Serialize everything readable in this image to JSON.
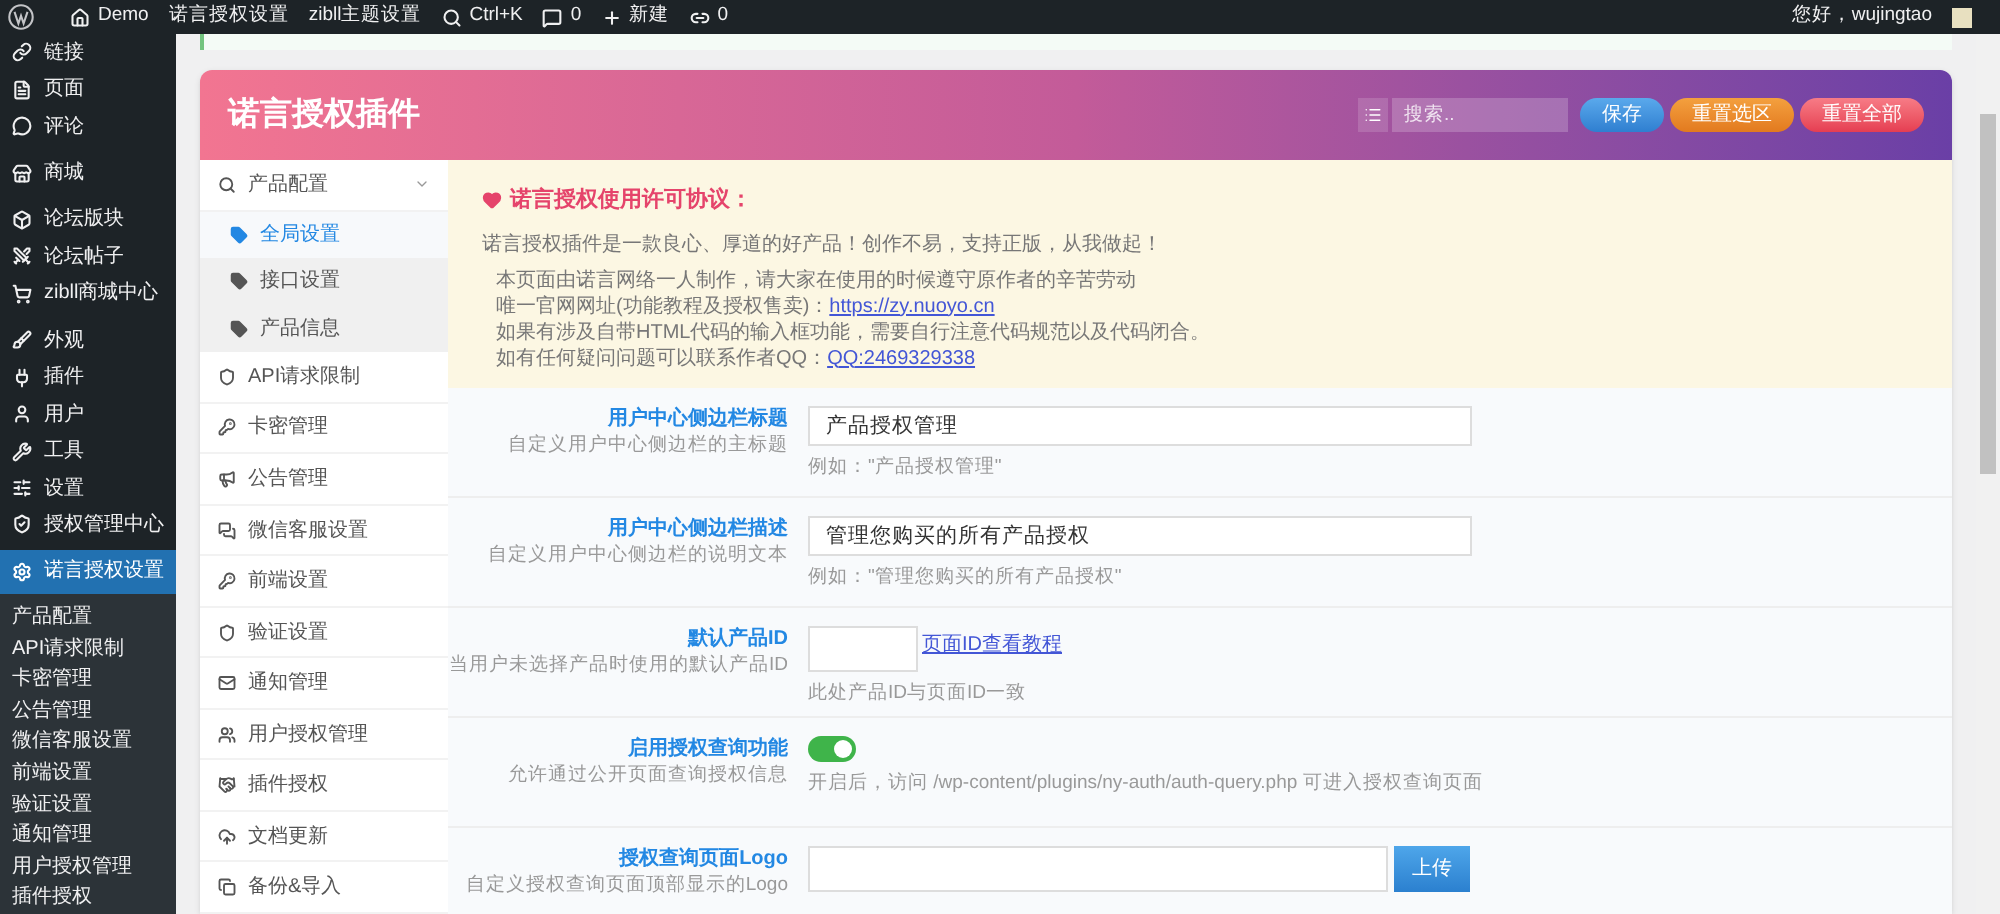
{
  "admin_bar": {
    "items": [
      {
        "kind": "logo"
      },
      {
        "kind": "home",
        "label": "Demo"
      },
      {
        "kind": "text",
        "label": "诺言授权设置"
      },
      {
        "kind": "text",
        "label": "zibll主题设置"
      },
      {
        "kind": "search",
        "label": "Ctrl+K"
      },
      {
        "kind": "comments",
        "label": "0"
      },
      {
        "kind": "new",
        "label": "新建"
      },
      {
        "kind": "links",
        "label": "0"
      }
    ],
    "greeting": "您好，wujingtao"
  },
  "sidebar": {
    "items": [
      {
        "label": "链接",
        "selected": false
      },
      {
        "label": "页面",
        "selected": false
      },
      {
        "label": "评论",
        "selected": false
      },
      {
        "label": "商城",
        "selected": false
      },
      {
        "label": "论坛版块",
        "selected": false
      },
      {
        "label": "论坛帖子",
        "selected": false
      },
      {
        "label": "zibll商城中心",
        "selected": false
      },
      {
        "label": "外观",
        "selected": false
      },
      {
        "label": "插件",
        "selected": false
      },
      {
        "label": "用户",
        "selected": false
      },
      {
        "label": "工具",
        "selected": false
      },
      {
        "label": "设置",
        "selected": false
      },
      {
        "label": "授权管理中心",
        "selected": false
      },
      {
        "label": "诺言授权设置",
        "selected": true
      }
    ],
    "submenu": [
      "产品配置",
      "API请求限制",
      "卡密管理",
      "公告管理",
      "微信客服设置",
      "前端设置",
      "验证设置",
      "通知管理",
      "用户授权管理",
      "插件授权"
    ]
  },
  "panel": {
    "title": "诺言授权插件",
    "search": {
      "placeholder": "搜索.."
    },
    "buttons": [
      {
        "label": "保存",
        "kind": "save"
      },
      {
        "label": "重置选区",
        "kind": "reset_section"
      },
      {
        "label": "重置全部",
        "kind": "reset_all"
      }
    ]
  },
  "nav": [
    {
      "label": "产品配置",
      "expanded": true,
      "children": [
        {
          "label": "全局设置",
          "selected": true
        },
        {
          "label": "接口设置",
          "selected": false
        },
        {
          "label": "产品信息",
          "selected": false
        }
      ]
    },
    {
      "label": "API请求限制"
    },
    {
      "label": "卡密管理"
    },
    {
      "label": "公告管理"
    },
    {
      "label": "微信客服设置"
    },
    {
      "label": "前端设置"
    },
    {
      "label": "验证设置"
    },
    {
      "label": "通知管理"
    },
    {
      "label": "用户授权管理"
    },
    {
      "label": "插件授权"
    },
    {
      "label": "文档更新"
    },
    {
      "label": "备份&导入"
    }
  ],
  "notice": {
    "title": "诺言授权使用许可协议：",
    "intro": "诺言授权插件是一款良心、厚道的好产品！创作不易，支持正版，从我做起！",
    "lines": [
      {
        "text": "本页面由诺言网络一人制作，请大家在使用的时候遵守原作者的辛苦劳动"
      },
      {
        "text": "唯一官网网址(功能教程及授权售卖)：",
        "link": "https://zy.nuoyo.cn"
      },
      {
        "text": "如果有涉及自带HTML代码的输入框功能，需要自行注意代码规范以及代码闭合。"
      },
      {
        "text": "如有任何疑问问题可以联系作者QQ：",
        "link": "QQ:2469329338"
      }
    ]
  },
  "fields": [
    {
      "kind": "text",
      "label": "用户中心侧边栏标题",
      "desc": "自定义用户中心侧边栏的主标题",
      "value": "产品授权管理",
      "help": "例如：\"产品授权管理\""
    },
    {
      "kind": "short",
      "label": "用户中心侧边栏描述",
      "desc": "自定义用户中心侧边栏的说明文本",
      "value": "管理您购买的所有产品授权",
      "help": "例如：\"管理您购买的所有产品授权\""
    },
    {
      "kind": "id",
      "label": "默认产品ID",
      "desc": "当用户未选择产品时使用的默认产品ID",
      "link": "页面ID查看教程",
      "help": "此处产品ID与页面ID一致"
    },
    {
      "kind": "switch",
      "label": "启用授权查询功能",
      "desc": "允许通过公开页面查询授权信息",
      "on": true,
      "help": "开启后，访问 /wp-content/plugins/ny-auth/auth-query.php 可进入授权查询页面"
    },
    {
      "kind": "upload",
      "label": "授权查询页面Logo",
      "desc": "自定义授权查询页面顶部显示的Logo",
      "button": "上传"
    }
  ]
}
